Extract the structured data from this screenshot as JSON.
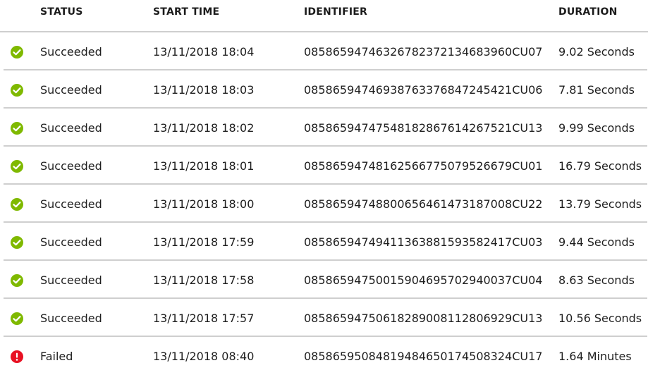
{
  "columns": {
    "status": "STATUS",
    "start_time": "START TIME",
    "identifier": "IDENTIFIER",
    "duration": "DURATION"
  },
  "colors": {
    "success": "#7fb900",
    "failed": "#e81123",
    "divider": "#cfcfcf"
  },
  "runs": [
    {
      "status": "Succeeded",
      "icon": "check-circle-icon",
      "start_time": "13/11/2018 18:04",
      "identifier": "08586594746326782372134683960CU07",
      "duration": "9.02 Seconds"
    },
    {
      "status": "Succeeded",
      "icon": "check-circle-icon",
      "start_time": "13/11/2018 18:03",
      "identifier": "08586594746938763376847245421CU06",
      "duration": "7.81 Seconds"
    },
    {
      "status": "Succeeded",
      "icon": "check-circle-icon",
      "start_time": "13/11/2018 18:02",
      "identifier": "08586594747548182867614267521CU13",
      "duration": "9.99 Seconds"
    },
    {
      "status": "Succeeded",
      "icon": "check-circle-icon",
      "start_time": "13/11/2018 18:01",
      "identifier": "08586594748162566775079526679CU01",
      "duration": "16.79 Seconds"
    },
    {
      "status": "Succeeded",
      "icon": "check-circle-icon",
      "start_time": "13/11/2018 18:00",
      "identifier": "08586594748800656461473187008CU22",
      "duration": "13.79 Seconds"
    },
    {
      "status": "Succeeded",
      "icon": "check-circle-icon",
      "start_time": "13/11/2018 17:59",
      "identifier": "08586594749411363881593582417CU03",
      "duration": "9.44 Seconds"
    },
    {
      "status": "Succeeded",
      "icon": "check-circle-icon",
      "start_time": "13/11/2018 17:58",
      "identifier": "08586594750015904695702940037CU04",
      "duration": "8.63 Seconds"
    },
    {
      "status": "Succeeded",
      "icon": "check-circle-icon",
      "start_time": "13/11/2018 17:57",
      "identifier": "08586594750618289008112806929CU13",
      "duration": "10.56 Seconds"
    },
    {
      "status": "Failed",
      "icon": "error-circle-icon",
      "start_time": "13/11/2018 08:40",
      "identifier": "08586595084819484650174508324CU17",
      "duration": "1.64 Minutes"
    }
  ]
}
